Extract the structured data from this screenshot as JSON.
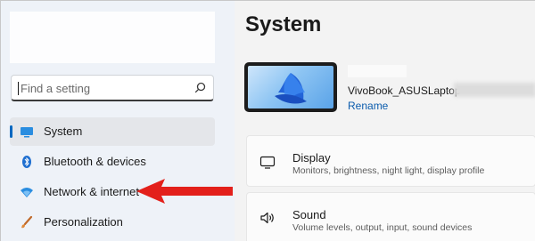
{
  "search": {
    "placeholder": "Find a setting"
  },
  "sidebar": {
    "items": [
      {
        "label": "System",
        "icon": "system-display-icon",
        "selected": true
      },
      {
        "label": "Bluetooth & devices",
        "icon": "bluetooth-icon",
        "selected": false
      },
      {
        "label": "Network & internet",
        "icon": "wifi-icon",
        "selected": false
      },
      {
        "label": "Personalization",
        "icon": "brush-icon",
        "selected": false
      }
    ]
  },
  "main": {
    "title": "System",
    "device": {
      "name": "VivoBook_ASUSLaptop",
      "rename_label": "Rename"
    },
    "cards": [
      {
        "title": "Display",
        "subtitle": "Monitors, brightness, night light, display profile",
        "icon": "monitor-icon"
      },
      {
        "title": "Sound",
        "subtitle": "Volume levels, output, input, sound devices",
        "icon": "speaker-icon"
      }
    ]
  },
  "colors": {
    "accent": "#0067c0",
    "arrow": "#e3201b",
    "sidebar_bg": "#eef2f8",
    "main_bg": "#f3f3f3"
  }
}
